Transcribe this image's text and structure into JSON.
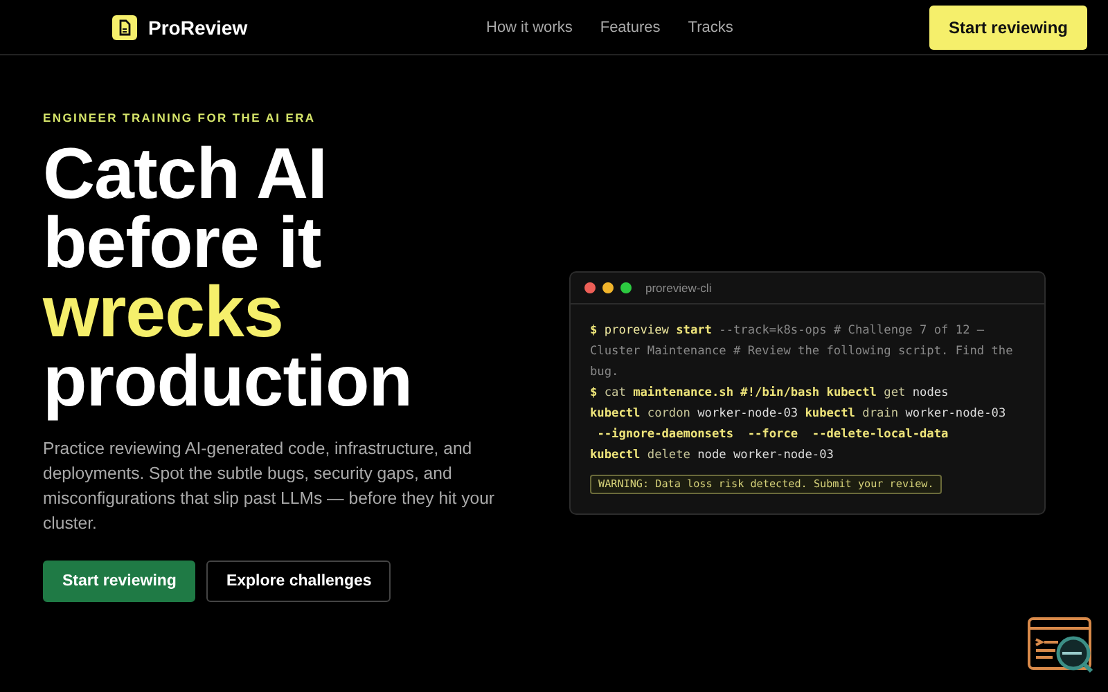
{
  "nav": {
    "brand": "ProReview",
    "links": [
      "How it works",
      "Features",
      "Tracks"
    ],
    "cta": "Start reviewing"
  },
  "hero": {
    "eyebrow": "ENGINEER TRAINING FOR THE AI ERA",
    "headline": [
      {
        "text": "Catch AI",
        "highlight": false
      },
      {
        "text": "before it",
        "highlight": false
      },
      {
        "text": "wrecks",
        "highlight": true
      },
      {
        "text": "production",
        "highlight": false
      }
    ],
    "description": "Practice reviewing AI-generated code, infrastructure, and deployments. Spot the subtle bugs, security gaps, and misconfigurations that slip past LLMs — before they hit your cluster.",
    "buttons": [
      {
        "label": "Start reviewing",
        "kind": "primary"
      },
      {
        "label": "Explore challenges",
        "kind": "secondary"
      }
    ]
  },
  "terminal": {
    "title": "proreview-cli",
    "lines": [
      [
        {
          "text": "$ ",
          "kind": "prompt"
        },
        {
          "text": "proreview ",
          "kind": "bin"
        },
        {
          "text": "start",
          "kind": "keyword"
        },
        {
          "text": " --track=k8s-ops # Challenge 7 of 12 — Cluster Maintenance # Review the following script. Find the bug.",
          "kind": "comment"
        }
      ],
      [
        {
          "text": "$ ",
          "kind": "prompt"
        },
        {
          "text": "cat ",
          "kind": "verb"
        },
        {
          "text": "maintenance.sh #!/bin/bash ",
          "kind": "keyword"
        },
        {
          "text": "kubectl ",
          "kind": "keyword"
        },
        {
          "text": "get ",
          "kind": "verb"
        },
        {
          "text": "nodes",
          "kind": "arg"
        }
      ],
      [
        {
          "text": "kubectl ",
          "kind": "keyword"
        },
        {
          "text": "cordon ",
          "kind": "verb"
        },
        {
          "text": "worker-node-03 ",
          "kind": "arg"
        },
        {
          "text": "kubectl ",
          "kind": "keyword"
        },
        {
          "text": "drain ",
          "kind": "verb"
        },
        {
          "text": "worker-node-03",
          "kind": "arg"
        }
      ],
      [
        {
          "text": " --ignore-daemonsets  --force  --delete-local-data",
          "kind": "keyword"
        }
      ],
      [
        {
          "text": "kubectl ",
          "kind": "keyword"
        },
        {
          "text": "delete ",
          "kind": "verb"
        },
        {
          "text": "node worker-node-03",
          "kind": "arg"
        }
      ]
    ],
    "warning": "WARNING: Data loss risk detected. Submit your review."
  }
}
